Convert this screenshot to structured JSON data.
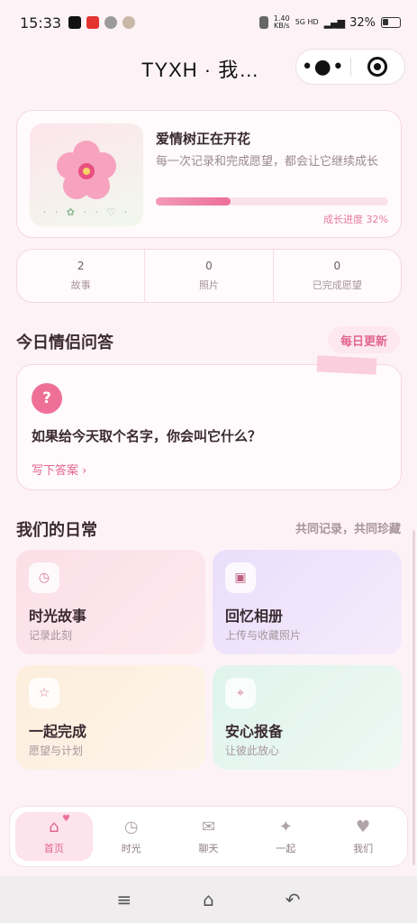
{
  "status_bar": {
    "time": "15:33",
    "network_speed": "1.40\nKB/s",
    "network_type": "5G HD",
    "battery": "32%"
  },
  "title_bar": {
    "title": "TYXH · 我…",
    "more_icon": "more-dots-icon",
    "close_icon": "target-close-icon"
  },
  "tree_card": {
    "title": "爱情树正在开花",
    "description": "每一次记录和完成愿望，都会让它继续成长",
    "progress_label": "成长进度 32%",
    "progress": 0.32,
    "decoration": "· · ✿ · · ♡ ·"
  },
  "stats": [
    {
      "value": "2",
      "label": "故事"
    },
    {
      "value": "0",
      "label": "照片"
    },
    {
      "value": "0",
      "label": "已完成愿望"
    }
  ],
  "qa": {
    "section_title": "今日情侣问答",
    "badge": "每日更新",
    "icon": "?",
    "question": "如果给今天取个名字，你会叫它什么？",
    "link": "写下答案 ›"
  },
  "daily": {
    "section_title": "我们的日常",
    "note": "共同记录，共同珍藏",
    "tiles": [
      {
        "title": "时光故事",
        "subtitle": "记录此刻",
        "icon": "◷",
        "icon_name": "clock-icon",
        "color": "#fbdfe7"
      },
      {
        "title": "回忆相册",
        "subtitle": "上传与收藏照片",
        "icon": "▣",
        "icon_name": "album-icon",
        "color": "#eadffb"
      },
      {
        "title": "一起完成",
        "subtitle": "愿望与计划",
        "icon": "☆",
        "icon_name": "star-icon",
        "color": "#fdeedd"
      },
      {
        "title": "安心报备",
        "subtitle": "让彼此放心",
        "icon": "⌖",
        "icon_name": "location-icon",
        "color": "#dff4ec"
      }
    ]
  },
  "tabs": [
    {
      "label": "首页",
      "icon": "⌂",
      "active": true
    },
    {
      "label": "时光",
      "icon": "◷",
      "active": false
    },
    {
      "label": "聊天",
      "icon": "✉",
      "active": false
    },
    {
      "label": "一起",
      "icon": "✦",
      "active": false
    },
    {
      "label": "我们",
      "icon": "♥",
      "active": false
    }
  ],
  "system_nav": {
    "menu": "≡",
    "home": "⌂",
    "back": "↶"
  },
  "colors": {
    "accent": "#ee7098",
    "background": "#fdf3f6",
    "text": "#3a2a31"
  }
}
